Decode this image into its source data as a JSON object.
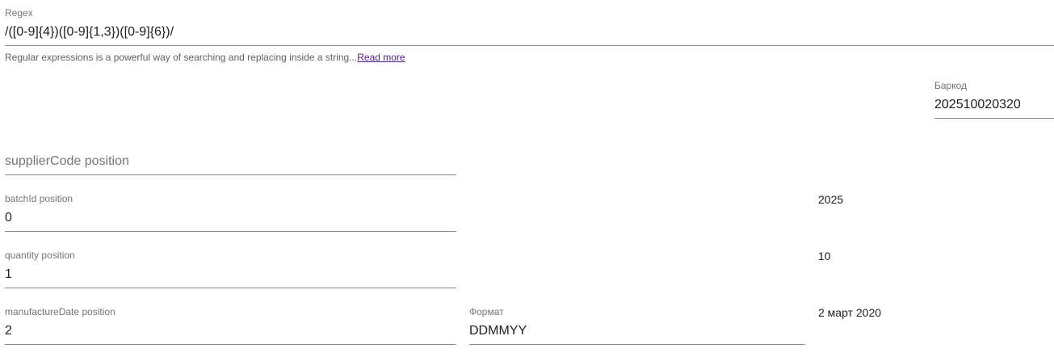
{
  "regex": {
    "label": "Regex",
    "value": "/([0-9]{4})([0-9]{1,3})([0-9]{6})/",
    "hint_text": "Regular expressions is a powerful way of searching and replacing inside a string...",
    "hint_link": "Read more"
  },
  "barcode": {
    "label": "Баркод",
    "value": "202510020320"
  },
  "supplier_code": {
    "placeholder": "supplierCode position",
    "value": ""
  },
  "batch_id": {
    "label": "batchId position",
    "value": "0",
    "result": "2025"
  },
  "quantity": {
    "label": "quantity position",
    "value": "1",
    "result": "10"
  },
  "manufacture_date": {
    "label": "manufactureDate position",
    "value": "2",
    "result": "2 март 2020"
  },
  "format": {
    "label": "Формат",
    "value": "DDMMYY"
  }
}
